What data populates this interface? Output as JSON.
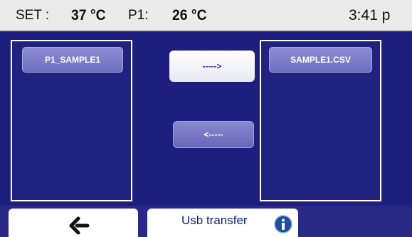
{
  "header": {
    "set_label": "SET :",
    "set_value": "37 °C",
    "p1_label": "P1:",
    "p1_value": "26 °C",
    "clock": "3:41 p"
  },
  "left_panel": {
    "files": [
      "P1_SAMPLE1"
    ]
  },
  "right_panel": {
    "files": [
      "SAMPLE1.CSV"
    ]
  },
  "transfer": {
    "to_right_label": "----->",
    "to_left_label": "<-----"
  },
  "footer": {
    "title": "Usb transfer",
    "back_icon": "back-arrow-icon",
    "info_icon": "info-icon"
  },
  "colors": {
    "background": "#1e1e7e",
    "header": "#ebebeb",
    "file_button": "#7a7ac6",
    "footer_text": "#0d1f7a"
  }
}
